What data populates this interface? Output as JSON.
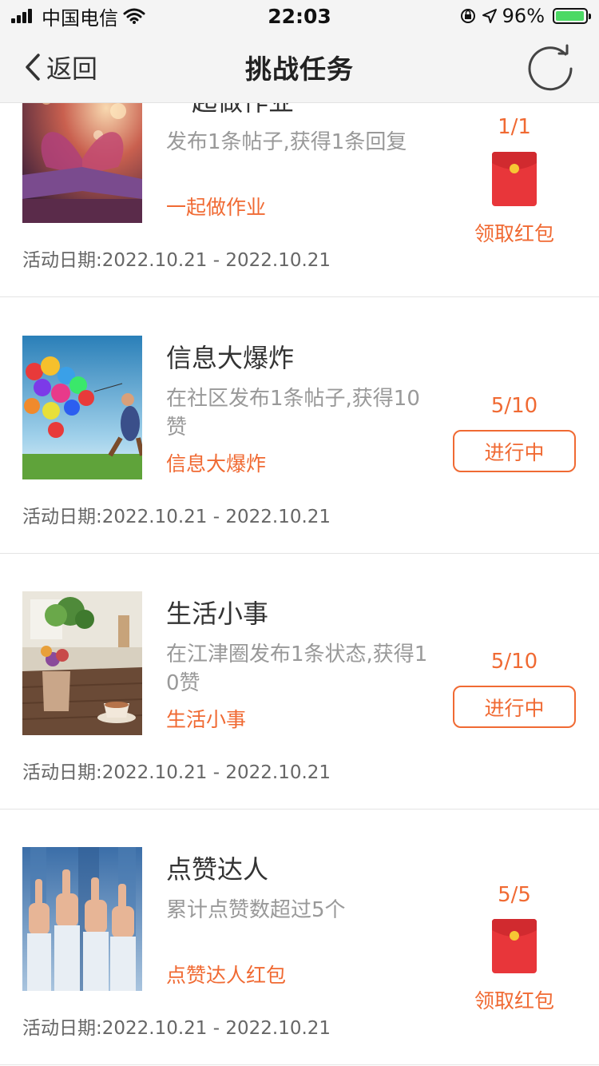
{
  "status_bar": {
    "carrier": "中国电信",
    "time": "22:03",
    "battery_percent": "96%",
    "battery_level": 0.96,
    "battery_color": "#4cd964"
  },
  "nav": {
    "back_label": "返回",
    "title": "挑战任务",
    "refresh_icon": "refresh-icon"
  },
  "colors": {
    "accent": "#f06a33",
    "envelope_red": "#e8363a",
    "envelope_seal": "#f7c734"
  },
  "tasks": [
    {
      "name": "一起做作业",
      "desc": "发布1条帖子,获得1条回复",
      "tag": "一起做作业",
      "date_label": "活动日期:",
      "date_range": "2022.10.21 - 2022.10.21",
      "progress": "1/1",
      "action": "领取红包",
      "thumb": "book-heart-photo"
    },
    {
      "name": "信息大爆炸",
      "desc": "在社区发布1条帖子,获得10赞",
      "tag": "信息大爆炸",
      "date_label": "活动日期:",
      "date_range": "2022.10.21 - 2022.10.21",
      "progress": "5/10",
      "action": "进行中",
      "thumb": "balloons-photo"
    },
    {
      "name": "生活小事",
      "desc": "在江津圈发布1条状态,获得10赞",
      "tag": "生活小事",
      "date_label": "活动日期:",
      "date_range": "2022.10.21 - 2022.10.21",
      "progress": "5/10",
      "action": "进行中",
      "thumb": "cafe-table-photo"
    },
    {
      "name": "点赞达人",
      "desc": "累计点赞数超过5个",
      "tag": "点赞达人红包",
      "date_label": "活动日期:",
      "date_range": "2022.10.21 - 2022.10.21",
      "progress": "5/5",
      "action": "领取红包",
      "thumb": "thumbs-up-photo"
    }
  ]
}
